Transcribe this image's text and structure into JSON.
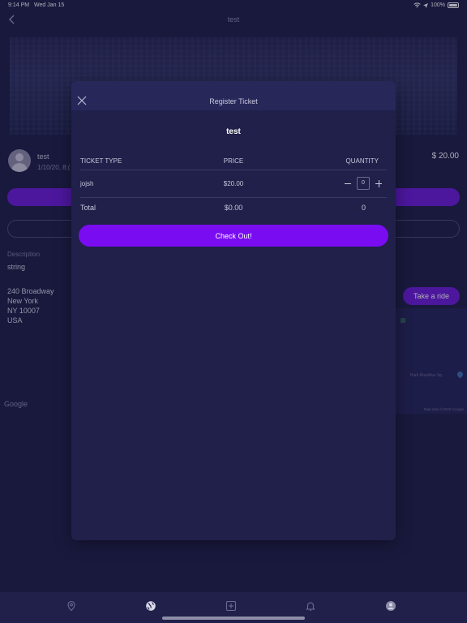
{
  "status_bar": {
    "time": "9:14 PM",
    "date": "Wed Jan 15",
    "battery": "100%"
  },
  "nav": {
    "title": "test",
    "back_icon": "chevron-left-icon"
  },
  "event": {
    "host_name": "test",
    "host_date": "1/10/20, 8:(",
    "price": "$ 20.00",
    "description_label": "Description",
    "description_value": "string",
    "address": [
      "240 Broadway",
      "New York",
      "NY 10007",
      "USA"
    ],
    "take_ride_label": "Take a ride",
    "map_attribution": "Google",
    "map_street": "Park Row/Ave Sq",
    "map_data": "Map data ©2020 Google"
  },
  "modal": {
    "title": "Register Ticket",
    "close_icon": "close-icon",
    "event_title": "test",
    "table": {
      "headers": {
        "type": "TICKET TYPE",
        "price": "PRICE",
        "quantity": "QUANTITY"
      },
      "rows": [
        {
          "type": "jojsh",
          "price": "$20.00",
          "quantity": "0"
        }
      ],
      "total": {
        "label": "Total",
        "price": "$0.00",
        "quantity": "0"
      }
    },
    "checkout_label": "Check Out!"
  },
  "tab_bar": {
    "items": [
      {
        "name": "location-pin-icon"
      },
      {
        "name": "globe-icon"
      },
      {
        "name": "add-square-icon"
      },
      {
        "name": "bell-icon"
      },
      {
        "name": "profile-icon"
      }
    ]
  },
  "colors": {
    "background": "#1d1c45",
    "modal": "#20204a",
    "accent": "#7a0cf2",
    "muted_text": "#8c8bb0"
  }
}
